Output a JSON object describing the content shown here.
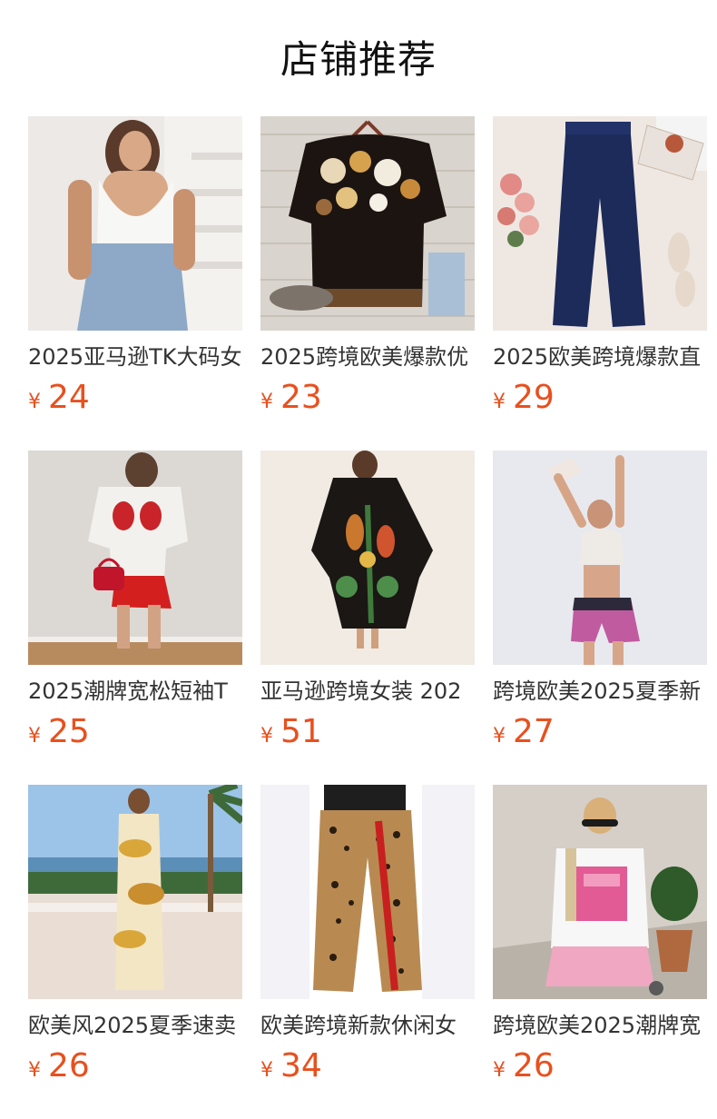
{
  "section": {
    "title": "店铺推荐"
  },
  "currency_symbol": "¥",
  "accent_color": "#e8501e",
  "products": [
    {
      "title": "2025亚马逊TK大码女",
      "price": "24",
      "image": "white-crop-top-denim-shorts-photo"
    },
    {
      "title": "2025跨境欧美爆款优",
      "price": "23",
      "image": "floral-tunic-top-photo"
    },
    {
      "title": "2025欧美跨境爆款直",
      "price": "29",
      "image": "navy-wide-leg-pants-photo"
    },
    {
      "title": "2025潮牌宽松短袖T",
      "price": "25",
      "image": "white-tee-red-skirt-photo"
    },
    {
      "title": "亚马逊跨境女装 202",
      "price": "51",
      "image": "black-kaftan-dress-photo"
    },
    {
      "title": "跨境欧美2025夏季新",
      "price": "27",
      "image": "bralette-pink-shorts-photo"
    },
    {
      "title": "欧美风2025夏季速卖",
      "price": "26",
      "image": "floral-maxi-dress-photo"
    },
    {
      "title": "欧美跨境新款休闲女",
      "price": "34",
      "image": "leopard-wide-pants-photo"
    },
    {
      "title": "跨境欧美2025潮牌宽",
      "price": "26",
      "image": "graphic-tee-pink-skirt-photo"
    }
  ]
}
